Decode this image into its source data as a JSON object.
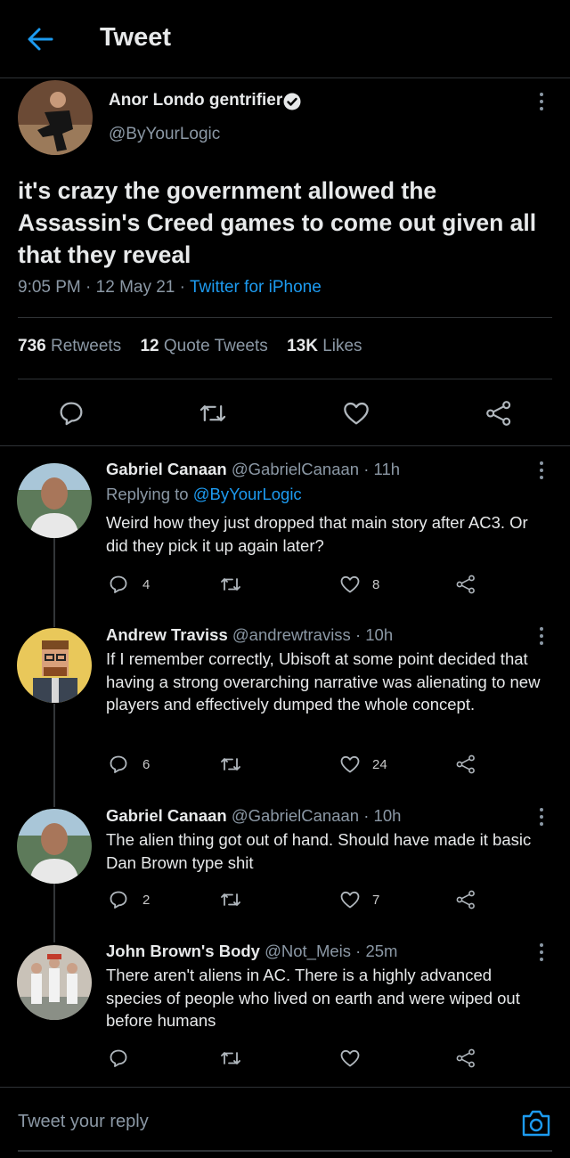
{
  "header": {
    "title": "Tweet"
  },
  "tweet": {
    "author_name": "Anor Londo gentrifier",
    "author_handle": "@ByYourLogic",
    "text": "it's crazy the government allowed the Assassin's Creed games to come out given all that they reveal",
    "time": "9:05 PM",
    "date": "12 May 21",
    "separator": "·",
    "source": "Twitter for iPhone",
    "stats": {
      "retweets_count": "736",
      "retweets_label": "Retweets",
      "quotes_count": "12",
      "quotes_label": "Quote Tweets",
      "likes_count": "13K",
      "likes_label": "Likes"
    }
  },
  "replies": [
    {
      "name": "Gabriel Canaan",
      "handle": "@GabrielCanaan",
      "time": "11h",
      "replying_to_label": "Replying to",
      "replying_to_handle": "@ByYourLogic",
      "text": "Weird how they just dropped that main story after AC3. Or did they pick it up again later?",
      "replies": "4",
      "likes": "8"
    },
    {
      "name": "Andrew Traviss",
      "handle": "@andrewtraviss",
      "time": "10h",
      "text": "If I remember correctly, Ubisoft at some point decided that having a strong overarching narrative was alienating to new players and effectively dumped the whole concept.",
      "replies": "6",
      "likes": "24"
    },
    {
      "name": "Gabriel Canaan",
      "handle": "@GabrielCanaan",
      "time": "10h",
      "text": "The alien thing got out of hand. Should have made it basic Dan Brown type shit",
      "replies": "2",
      "likes": "7"
    },
    {
      "name": "John Brown's Body",
      "handle": "@Not_Meis",
      "time": "25m",
      "text": "There aren't aliens in AC. There is a highly advanced species of people who lived on earth and were wiped out before humans"
    }
  ],
  "compose": {
    "placeholder": "Tweet your reply"
  },
  "colors": {
    "accent": "#1d9bf0",
    "background": "#000000",
    "muted": "#8b98a5"
  },
  "icons": [
    "back-arrow-icon",
    "verified-badge-icon",
    "more-options-icon",
    "reply-icon",
    "retweet-icon",
    "like-icon",
    "share-icon",
    "camera-icon"
  ]
}
